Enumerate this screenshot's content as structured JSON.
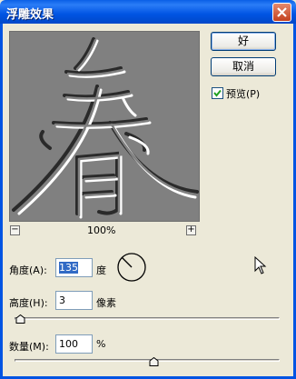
{
  "window": {
    "title": "浮雕效果"
  },
  "buttons": {
    "ok": "好",
    "cancel": "取消"
  },
  "preview_checkbox": {
    "label": "预览(P)",
    "checked": true
  },
  "zoom": {
    "level": "100%",
    "out": "−",
    "in": "+"
  },
  "angle": {
    "label": "角度(A):",
    "value": "135",
    "unit": "度"
  },
  "height": {
    "label": "高度(H):",
    "value": "3",
    "unit": "像素",
    "slider_fraction": 0.02
  },
  "amount": {
    "label": "数量(M):",
    "value": "100",
    "unit": "%",
    "slider_fraction": 0.2
  },
  "colors": {
    "titlebar": "#0054E3",
    "dialog": "#ECE9D8",
    "preview_bg": "#808080"
  },
  "icons": {
    "close": "close-icon",
    "angle": "angle-dial-icon",
    "cursor": "mouse-pointer-icon"
  }
}
